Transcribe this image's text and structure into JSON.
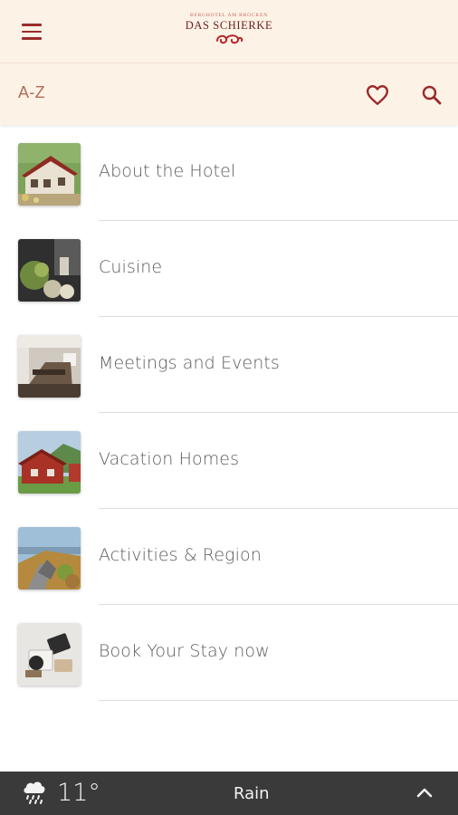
{
  "header": {
    "logo_tagline": "Berghotel am Brocken",
    "logo_name": "DAS SCHIERKE"
  },
  "subheader": {
    "sort_label": "A-Z"
  },
  "menu_items": [
    {
      "label": "About the Hotel"
    },
    {
      "label": "Cuisine"
    },
    {
      "label": "Meetings and Events"
    },
    {
      "label": "Vacation Homes"
    },
    {
      "label": "Activities & Region"
    },
    {
      "label": "Book Your Stay now"
    }
  ],
  "weather": {
    "temperature": "11°",
    "condition": "Rain"
  },
  "colors": {
    "accent": "#9a2a2a",
    "header_bg": "#fdf2e6",
    "weather_bar_bg": "#3a3a3a"
  },
  "icons": [
    "menu-icon",
    "heart-icon",
    "search-icon",
    "rain-cloud-icon",
    "chevron-up-icon"
  ]
}
